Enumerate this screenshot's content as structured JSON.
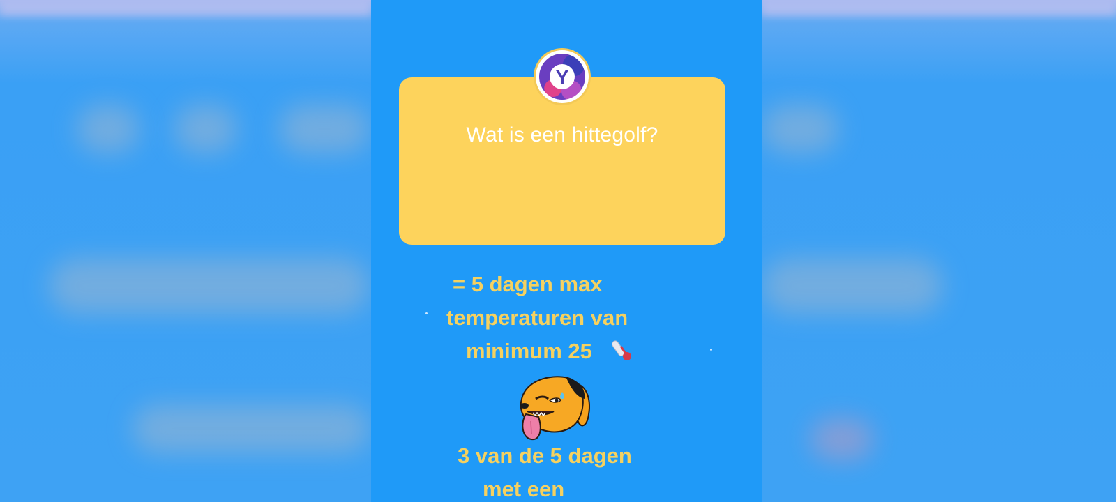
{
  "story": {
    "avatar_letter": "Y",
    "question": "Wat is een hittegolf?",
    "answer_lines": [
      "= 5 dagen max",
      "temperaturen van",
      "minimum 25",
      "3 van de 5 dagen",
      "met een"
    ],
    "icons": [
      "thermometer-icon",
      "sweating-dog-sticker"
    ]
  },
  "colors": {
    "story_background": "#1f9af8",
    "card": "#fdd35c",
    "answer_text": "#f5d160",
    "question_text": "#ffffff"
  }
}
